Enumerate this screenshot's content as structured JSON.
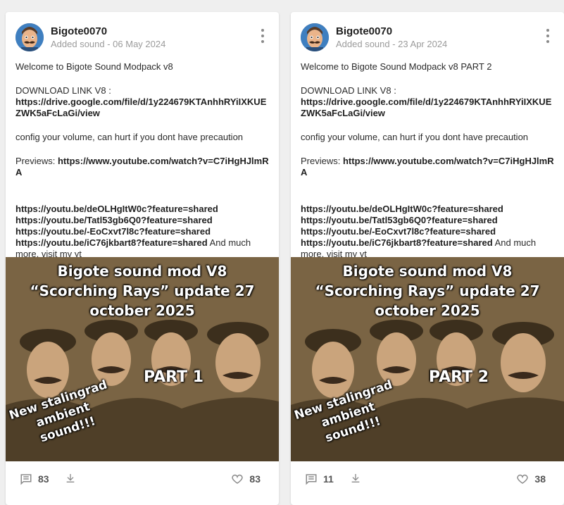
{
  "cards": [
    {
      "author": "Bigote0070",
      "meta": "Added sound - 06 May 2024",
      "title": "Welcome to Bigote Sound Modpack v8",
      "download_label": "DOWNLOAD LINK V8 :",
      "download_url": "https://drive.google.com/file/d/1y224679KTAnhhRYiIXKUEZWK5aFcLaGi/view",
      "warning": "config your volume, can hurt if you dont have precaution",
      "previews_label": "Previews:",
      "previews_url": "https://www.youtube.com/watch?v=C7iHgHJlmRA",
      "links": [
        "https://youtu.be/deOLHgItW0c?feature=shared",
        "https://youtu.be/Tatl53gb6Q0?feature=shared",
        "https://youtu.be/-EoCxvt7l8c?feature=shared",
        "https://youtu.be/iC76jkbart8?feature=shared"
      ],
      "tail": " And much more, visit my yt",
      "image": {
        "title_line1": "Bigote sound mod V8",
        "title_line2": "“Scorching Rays” update 27",
        "title_line3": "october 2025",
        "part": "PART 1",
        "ambient_line1": "New stalingrad",
        "ambient_line2": "ambient",
        "ambient_line3": "sound!!!"
      },
      "comments": "83",
      "likes": "83"
    },
    {
      "author": "Bigote0070",
      "meta": "Added sound - 23 Apr 2024",
      "title": "Welcome to Bigote Sound Modpack v8 PART 2",
      "download_label": "DOWNLOAD LINK V8 :",
      "download_url": "https://drive.google.com/file/d/1y224679KTAnhhRYiIXKUEZWK5aFcLaGi/view",
      "warning": "config your volume, can hurt if you dont have precaution",
      "previews_label": "Previews:",
      "previews_url": "https://www.youtube.com/watch?v=C7iHgHJlmRA",
      "links": [
        "https://youtu.be/deOLHgItW0c?feature=shared",
        "https://youtu.be/Tatl53gb6Q0?feature=shared",
        "https://youtu.be/-EoCxvt7l8c?feature=shared",
        "https://youtu.be/iC76jkbart8?feature=shared"
      ],
      "tail": " And much more, visit my yt",
      "image": {
        "title_line1": "Bigote sound mod V8",
        "title_line2": "“Scorching Rays” update 27",
        "title_line3": "october 2025",
        "part": "PART 2",
        "ambient_line1": "New stalingrad",
        "ambient_line2": "ambient",
        "ambient_line3": "sound!!!"
      },
      "comments": "11",
      "likes": "38"
    }
  ],
  "icons": {
    "comment": "comment-icon",
    "download": "download-icon",
    "like": "heart-icon",
    "more": "more-vertical-icon"
  },
  "colors": {
    "background": "#efefef",
    "card": "#ffffff",
    "text": "#2b2b2b",
    "muted": "#9b9b9b"
  }
}
